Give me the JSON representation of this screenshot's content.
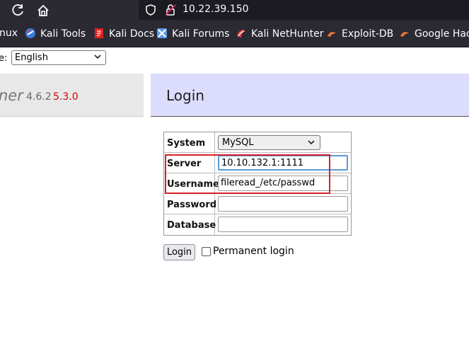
{
  "browser": {
    "url": "10.22.39.150",
    "bookmarks": [
      {
        "label": "nux",
        "icon": "kali-linux-icon"
      },
      {
        "label": "Kali Tools",
        "icon": "kali-tools-icon"
      },
      {
        "label": "Kali Docs",
        "icon": "kali-docs-icon"
      },
      {
        "label": "Kali Forums",
        "icon": "kali-forums-icon"
      },
      {
        "label": "Kali NetHunter",
        "icon": "kali-nethunter-icon"
      },
      {
        "label": "Exploit-DB",
        "icon": "exploit-db-icon"
      },
      {
        "label": "Google Hack",
        "icon": "google-hacking-icon"
      }
    ]
  },
  "language": {
    "label": "e:",
    "selected": "English"
  },
  "logo": {
    "brand": "ner",
    "version": "4.6.2",
    "version2": "5.3.0"
  },
  "login": {
    "title": "Login",
    "fields": {
      "system_label": "System",
      "system_value": "MySQL",
      "server_label": "Server",
      "server_value": "10.10.132.1:1111",
      "username_label": "Username",
      "username_value": "fileread_/etc/passwd",
      "password_label": "Password",
      "password_value": "",
      "database_label": "Database",
      "database_value": ""
    },
    "button_label": "Login",
    "permanent_label": "Permanent login"
  },
  "colors": {
    "header_bg": "#dcdcfd",
    "highlight": "#d3222a",
    "version_red": "#d40000"
  }
}
